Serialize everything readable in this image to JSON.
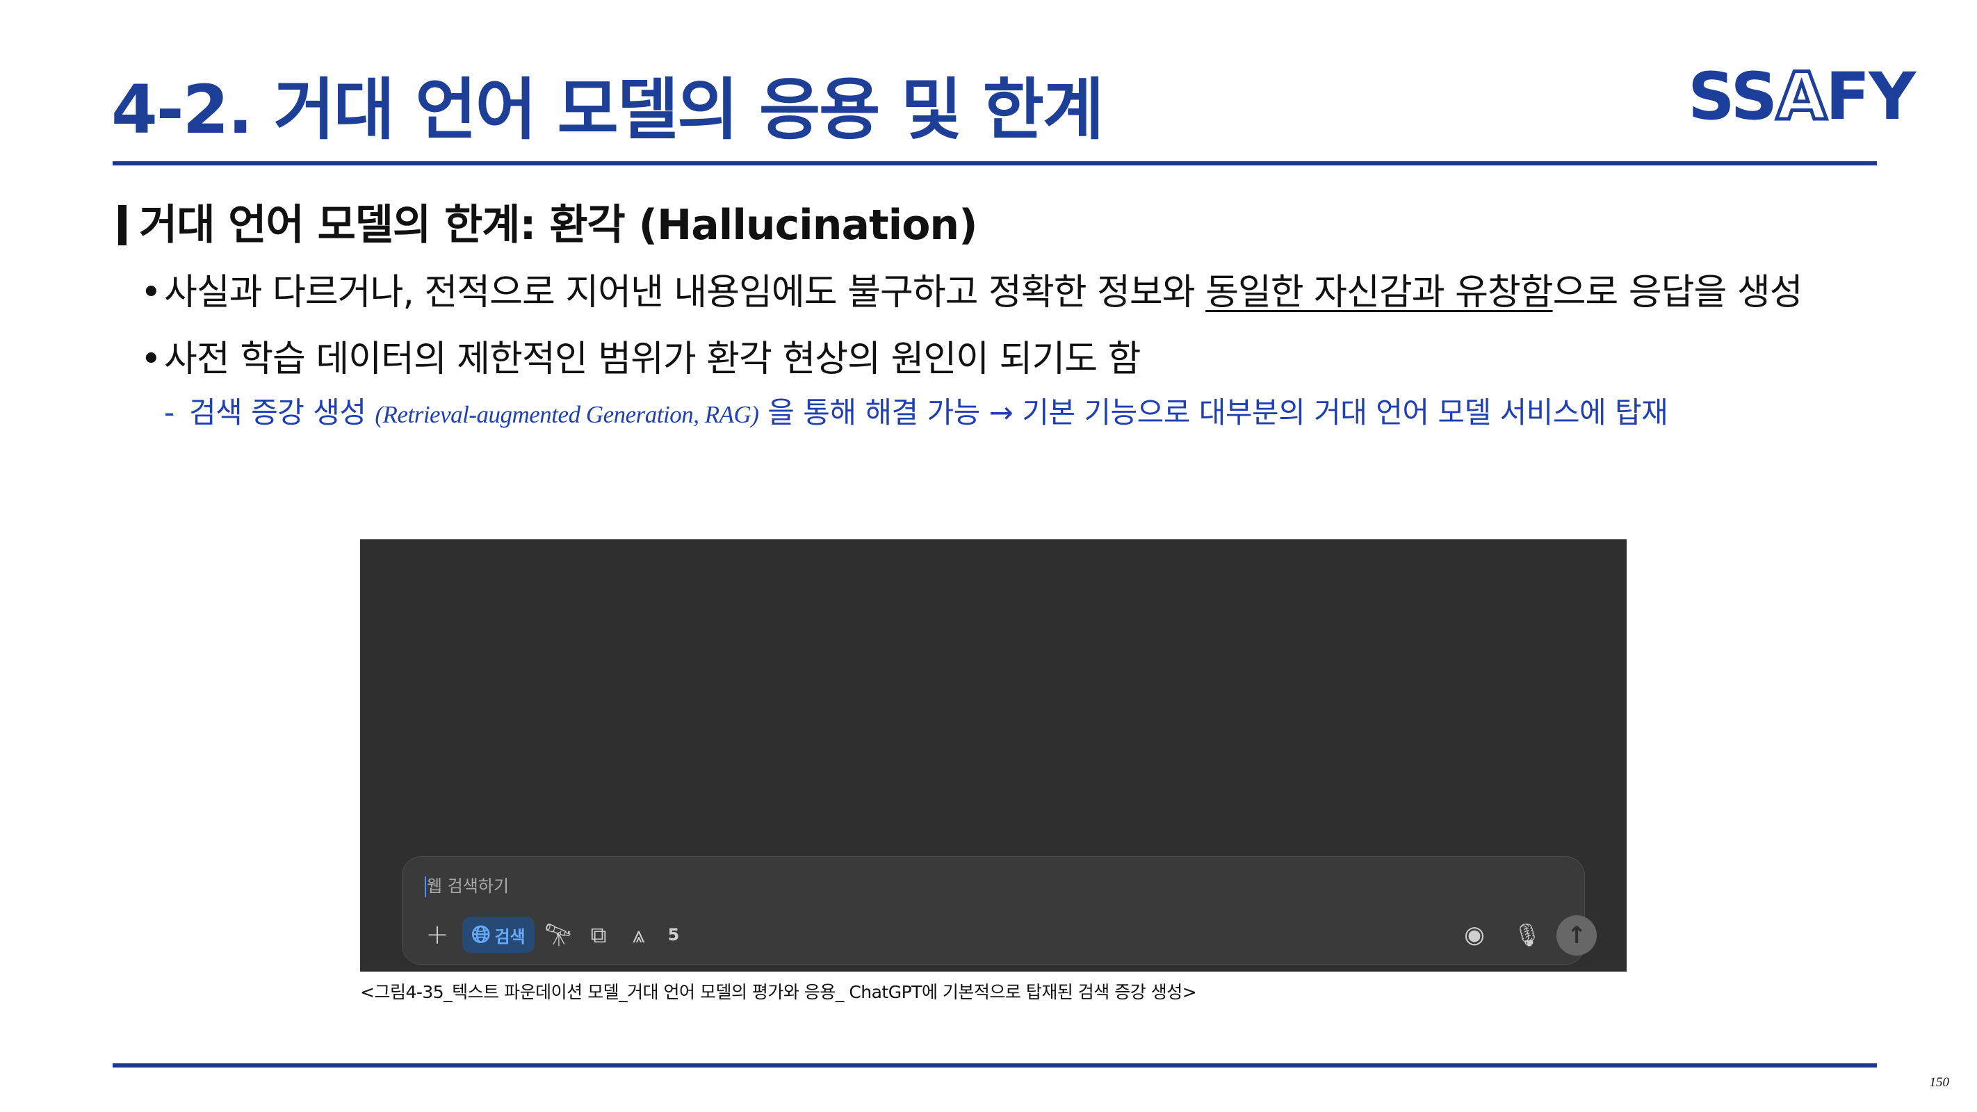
{
  "colors": {
    "brand_blue": "#1b3f9a",
    "title": "#1d3f98",
    "body_text": "#111111",
    "sub_bullet": "#1f3fb5",
    "rule": "#1b3a8c",
    "screenshot_bg": "#2f2f2f",
    "composer_bg": "#3a3a3a",
    "composer_text": "#a9a9a9",
    "icon_light": "#cfcfcf",
    "search_chip_bg": "#264a73",
    "search_chip_text": "#66aaff",
    "send_bg": "#676767",
    "send_icon": "#2f2f2f",
    "caret": "#4a90ff"
  },
  "header": {
    "title": "4-2. 거대 언어 모델의 응용 및 한계",
    "logo": {
      "part_ss": "SS",
      "part_a": "A",
      "part_fy": "FY"
    }
  },
  "section": {
    "heading": "거대 언어 모델의 한계: 환각 (Hallucination)"
  },
  "bullets": [
    {
      "marker": "•",
      "text_plain": "사실과 다르거나, 전적으로 지어낸 내용임에도 불구하고 정확한 정보와 ",
      "text_underlined": "동일한 자신감과 유창함",
      "text_after": "으로 응답을 생성"
    },
    {
      "marker": "•",
      "text_plain": "사전 학습 데이터의 제한적인 범위가 환각 현상의 원인이 되기도 함"
    }
  ],
  "sub_bullet": {
    "marker": "-",
    "text_before": "검색 증강 생성 ",
    "term_en": "(Retrieval-augmented Generation, RAG)",
    "text_after": " 을 통해 해결 가능 → 기본 기능으로 대부분의 거대 언어 모델 서비스에 탑재"
  },
  "screenshot": {
    "composer": {
      "placeholder": "웹 검색하기",
      "tools": {
        "plus_icon": "plus-icon",
        "search_chip_label": "검색",
        "search_icon": "globe-icon",
        "telescope_icon": "telescope-icon",
        "canvas_icon": "canvas-icon",
        "apps_icon": "apps-icon",
        "count": "5",
        "record_icon": "record-icon",
        "mic_icon": "microphone-icon",
        "send_icon": "arrow-up-icon"
      }
    }
  },
  "caption": "<그림4-35_텍스트 파운데이션 모델_거대 언어 모델의 평가와 응용_ ChatGPT에 기본적으로 탑재된 검색 증강 생성>",
  "page_number": "150"
}
